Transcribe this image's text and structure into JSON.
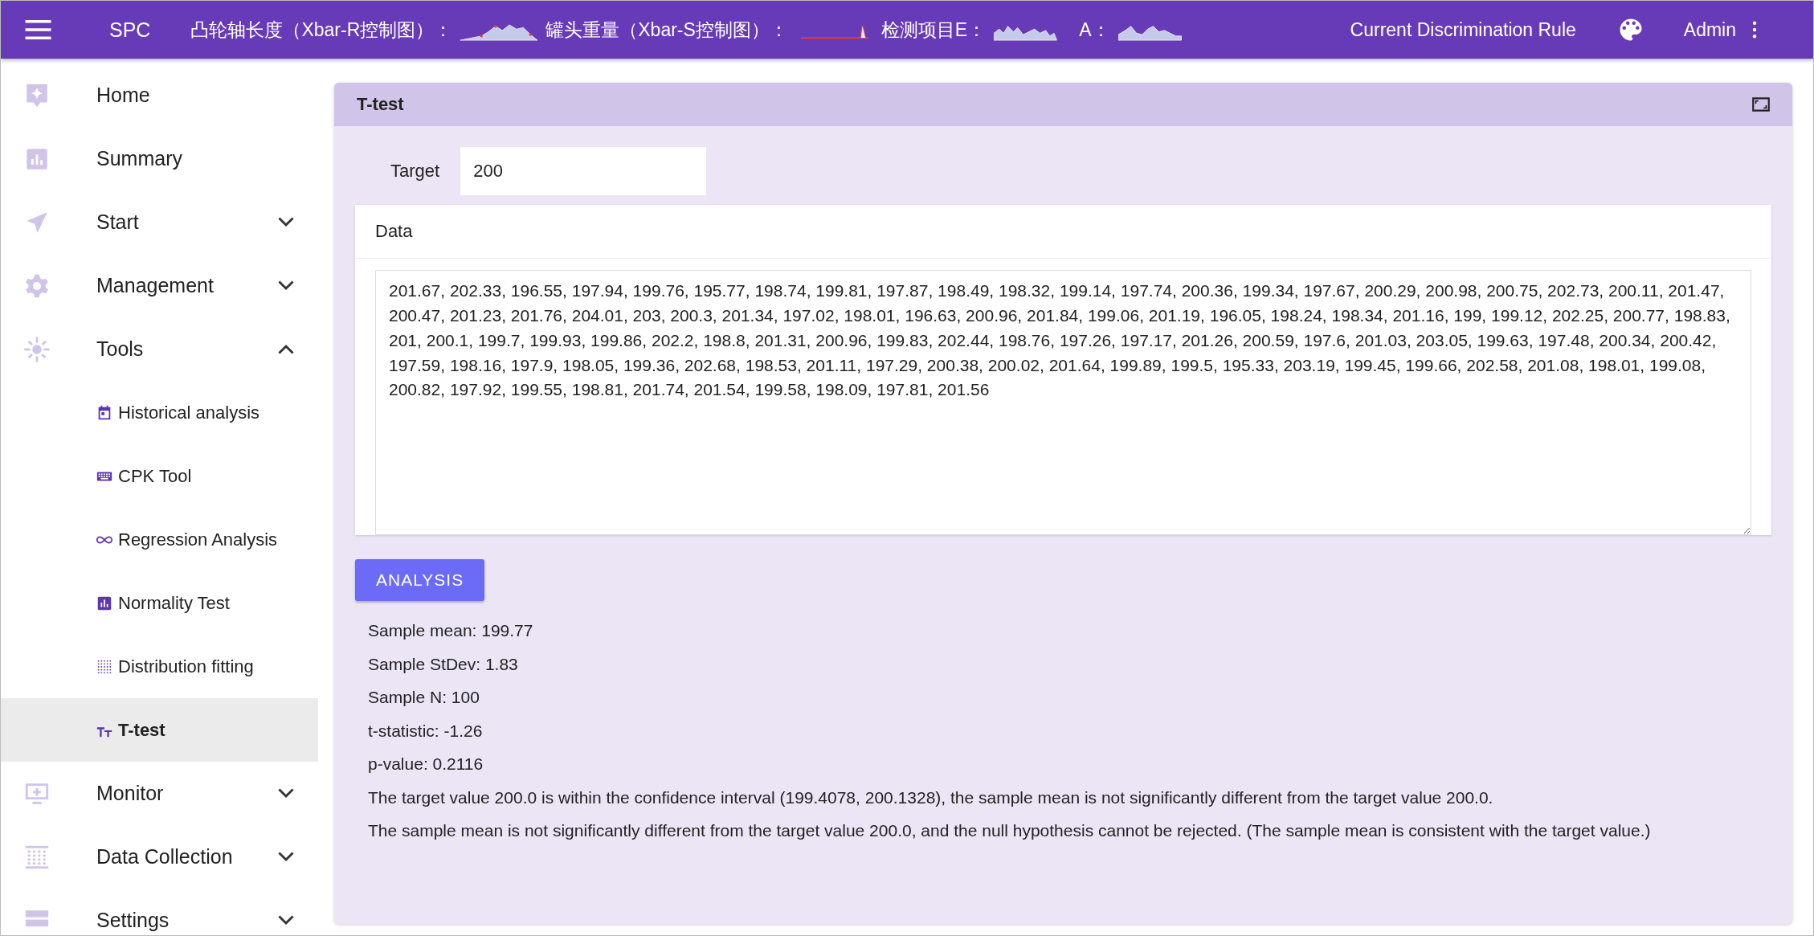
{
  "header": {
    "title": "SPC",
    "monitors": [
      {
        "label": "凸轮轴长度（Xbar-R控制图）："
      },
      {
        "label": "罐头重量（Xbar-S控制图）："
      },
      {
        "label": "检测项目E："
      },
      {
        "label": "A："
      }
    ],
    "rule_link": "Current Discrimination Rule",
    "user": "Admin"
  },
  "sidebar": {
    "items": [
      {
        "label": "Home",
        "selected": false
      },
      {
        "label": "Summary",
        "selected": false
      },
      {
        "label": "Start",
        "expanded": false,
        "selected": false
      },
      {
        "label": "Management",
        "expanded": false,
        "selected": false
      },
      {
        "label": "Tools",
        "expanded": true,
        "selected": false,
        "children": [
          {
            "label": "Historical analysis",
            "selected": false
          },
          {
            "label": "CPK Tool",
            "selected": false
          },
          {
            "label": "Regression Analysis",
            "selected": false
          },
          {
            "label": "Normality Test",
            "selected": false
          },
          {
            "label": "Distribution fitting",
            "selected": false
          },
          {
            "label": "T-test",
            "selected": true
          }
        ]
      },
      {
        "label": "Monitor",
        "expanded": false,
        "selected": false
      },
      {
        "label": "Data Collection",
        "expanded": false,
        "selected": false
      },
      {
        "label": "Settings",
        "expanded": false,
        "selected": false
      }
    ]
  },
  "panel": {
    "title": "T-test",
    "target": {
      "label": "Target",
      "value": "200"
    },
    "data": {
      "label": "Data",
      "value": "201.67, 202.33, 196.55, 197.94, 199.76, 195.77, 198.74, 199.81, 197.87, 198.49, 198.32, 199.14, 197.74, 200.36, 199.34, 197.67, 200.29, 200.98, 200.75, 202.73, 200.11, 201.47, 200.47, 201.23, 201.76, 204.01, 203, 200.3, 201.34, 197.02, 198.01, 196.63, 200.96, 201.84, 199.06, 201.19, 196.05, 198.24, 198.34, 201.16, 199, 199.12, 202.25, 200.77, 198.83, 201, 200.1, 199.7, 199.93, 199.86, 202.2, 198.8, 201.31, 200.96, 199.83, 202.44, 198.76, 197.26, 197.17, 201.26, 200.59, 197.6, 201.03, 203.05, 199.63, 197.48, 200.34, 200.42, 197.59, 198.16, 197.9, 198.05, 199.36, 202.68, 198.53, 201.11, 197.29, 200.38, 200.02, 201.64, 199.89, 199.5, 195.33, 203.19, 199.45, 199.66, 202.58, 201.08, 198.01, 199.08, 200.82, 197.92, 199.55, 198.81, 201.74, 201.54, 199.58, 198.09, 197.81, 201.56"
    },
    "button": "ANALYSIS",
    "results": [
      "Sample mean: 199.77",
      "Sample StDev: 1.83",
      "Sample N: 100",
      "t-statistic: -1.26",
      "p-value: 0.2116",
      "The target value 200.0 is within the confidence interval (199.4078, 200.1328), the sample mean is not significantly different from the target value 200.0.",
      "The sample mean is not significantly different from the target value 200.0, and the null hypothesis cannot be rejected. (The sample mean is consistent with the target value.)"
    ]
  }
}
